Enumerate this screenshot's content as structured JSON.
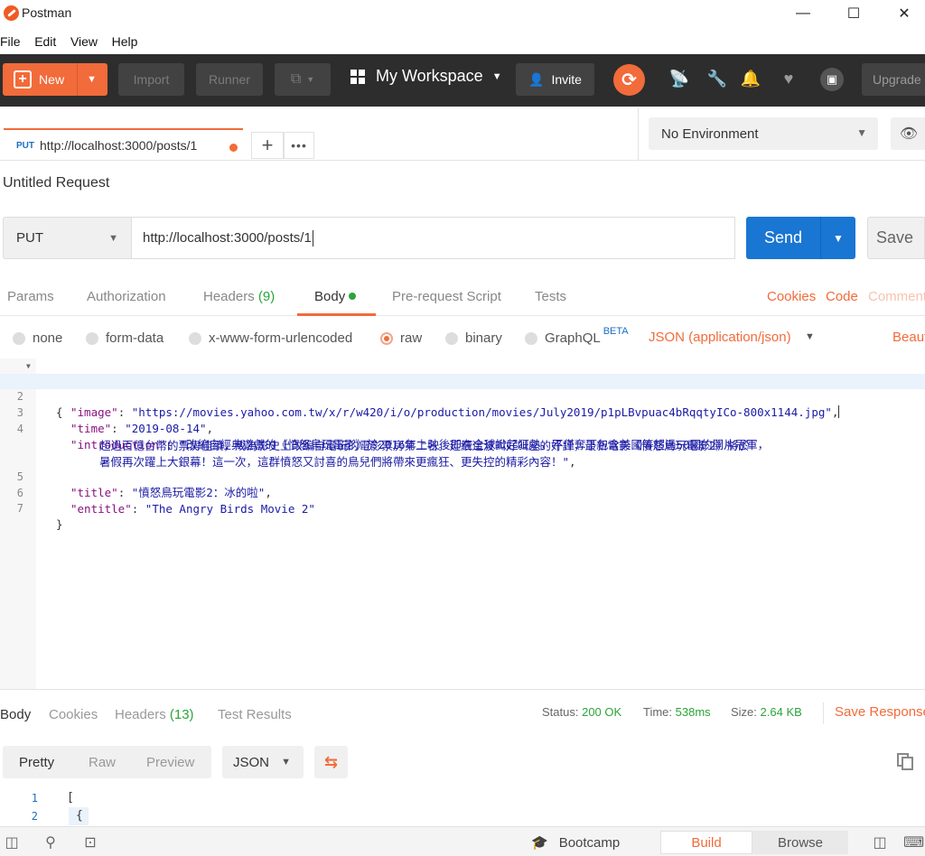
{
  "window": {
    "title": "Postman",
    "controls": [
      "—",
      "☐",
      "✕"
    ]
  },
  "menu": [
    "File",
    "Edit",
    "View",
    "Help"
  ],
  "toolbar": {
    "new_label": "New",
    "import_label": "Import",
    "runner_label": "Runner",
    "workspace_label": "My Workspace",
    "invite_label": "Invite",
    "upgrade_label": "Upgrade"
  },
  "tab": {
    "method": "PUT",
    "url": "http://localhost:3000/posts/1"
  },
  "environment": {
    "selected": "No Environment"
  },
  "request": {
    "title": "Untitled Request",
    "method": "PUT",
    "url": "http://localhost:3000/posts/1",
    "send_label": "Send",
    "save_label": "Save"
  },
  "request_tabs": {
    "params": "Params",
    "authorization": "Authorization",
    "headers": "Headers",
    "headers_count": "(9)",
    "body": "Body",
    "prerequest": "Pre-request Script",
    "tests": "Tests",
    "cookies": "Cookies",
    "code": "Code",
    "comments": "Comments"
  },
  "body_types": {
    "none": "none",
    "form_data": "form-data",
    "urlencoded": "x-www-form-urlencoded",
    "raw": "raw",
    "binary": "binary",
    "graphql": "GraphQL",
    "beta": "BETA",
    "content_type": "JSON (application/json)",
    "beautify": "Beautify"
  },
  "editor": {
    "lines": [
      {
        "num": "1",
        "open": "{"
      },
      {
        "num": "2",
        "key": "\"image\"",
        "value": "\"https://movies.yahoo.com.tw/x/r/w420/i/o/production/movies/July2019/p1pLBvpuac4bRqqtyICo-800x1144.jpg\""
      },
      {
        "num": "3",
        "key": "\"time\"",
        "value": "\"2019-08-14\""
      },
      {
        "num": "4",
        "key": "\"introduction\"",
        "value_1": "\"改編自經典遊戲的《憤怒鳥玩電影》於2016年上映後即在全球掀起狂熱，不僅奪下包含美國等超過50國的開片冠軍，",
        "value_2": "超過百億台幣的票房佳績，成為影史上改編自電玩的電影票房第二名。延續這波叫好叫座的好評，最新電影《憤怒鳥玩電影2》將於",
        "value_3": "暑假再次躍上大銀幕！這一次，這群憤怒又討喜的鳥兒們將帶來更瘋狂、更失控的精彩內容！\""
      },
      {
        "num": "5",
        "key": "\"title\"",
        "value": "\"憤怒鳥玩電影2：冰的啦\""
      },
      {
        "num": "6",
        "key": "\"entitle\"",
        "value": "\"The Angry Birds Movie 2\""
      },
      {
        "num": "7",
        "close": "}"
      }
    ]
  },
  "response": {
    "tabs": {
      "body": "Body",
      "cookies": "Cookies",
      "headers": "Headers",
      "headers_count": "(13)",
      "tests": "Test Results"
    },
    "status_label": "Status:",
    "status": "200 OK",
    "time_label": "Time:",
    "time": "538ms",
    "size_label": "Size:",
    "size": "2.64 KB",
    "save_label": "Save Response",
    "view": {
      "pretty": "Pretty",
      "raw": "Raw",
      "preview": "Preview",
      "format": "JSON"
    },
    "lines": [
      {
        "num": "1",
        "text": "["
      },
      {
        "num": "2",
        "text": "{"
      }
    ]
  },
  "statusbar": {
    "bootcamp": "Bootcamp",
    "build": "Build",
    "browse": "Browse"
  },
  "colors": {
    "accent": "#f26b3a",
    "send": "#1976d2",
    "toolbar": "#2d2d2d",
    "success": "#2ca43a"
  }
}
